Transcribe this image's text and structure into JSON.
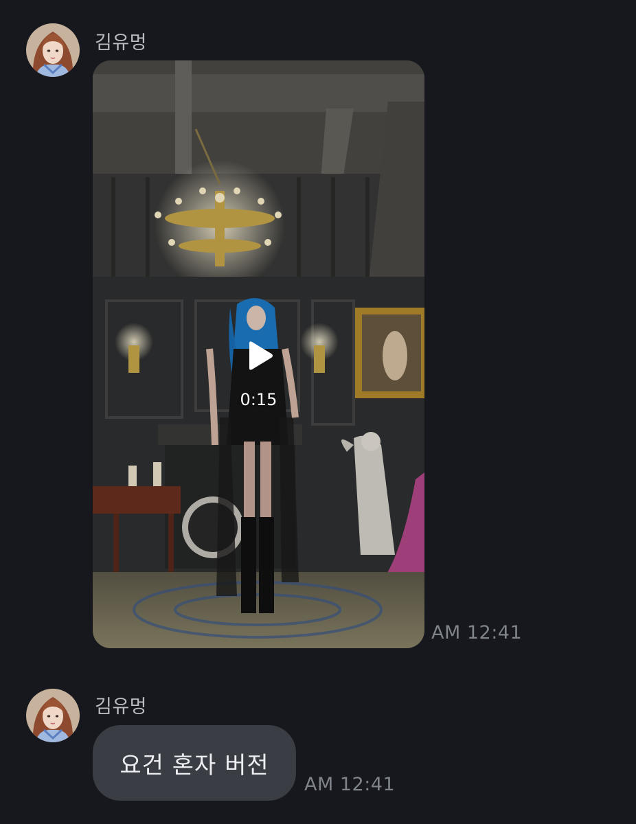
{
  "messages": [
    {
      "type": "video",
      "sender": "김유멍",
      "duration": "0:15",
      "time": "AM 12:41"
    },
    {
      "type": "text",
      "sender": "김유멍",
      "text": "요건 혼자 버전",
      "time": "AM 12:41"
    }
  ],
  "colors": {
    "background": "#16181d",
    "bubble": "#3a3e44",
    "sender_text": "#b9bcc2",
    "time_text": "#7f838a",
    "bubble_text": "#eceef1"
  },
  "icons": {
    "play": "play-icon"
  }
}
